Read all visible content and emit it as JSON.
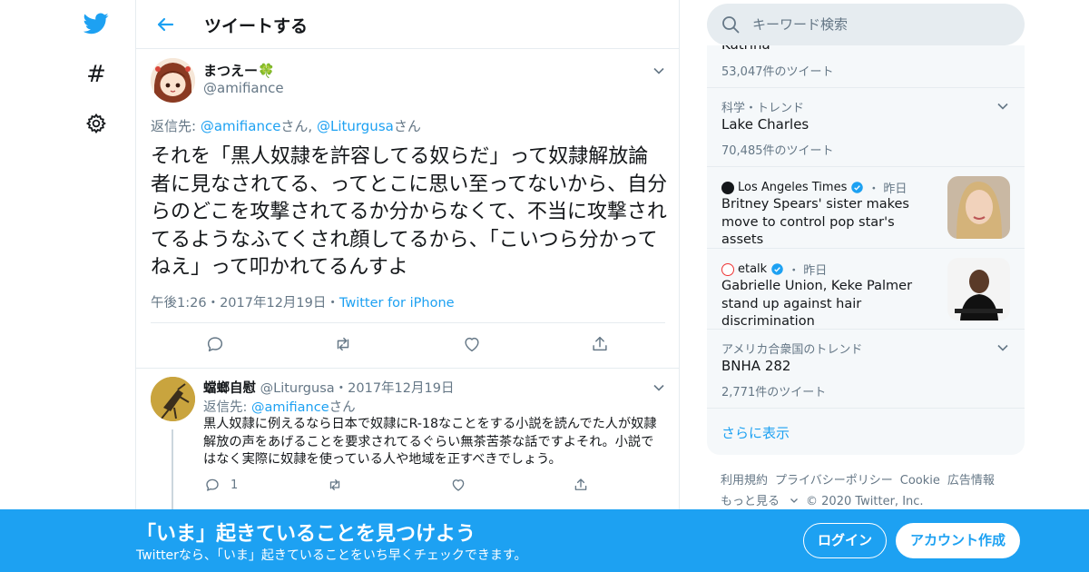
{
  "header": {
    "title": "ツイートする"
  },
  "nav": {
    "hash_symbol": "#"
  },
  "tweet": {
    "user_name": "まつえー🍀",
    "handle": "@amifiance",
    "reply_to_prefix": "返信先: ",
    "reply_to_users": [
      {
        "handle": "@amifiance",
        "suffix": "さん, "
      },
      {
        "handle": "@Liturgusa",
        "suffix": "さん"
      }
    ],
    "text": "それを「黒人奴隷を許容してる奴らだ」って奴隷解放論者に見なされてる、ってとこに思い至ってないから、自分らのどこを攻撃されてるか分からなくて、不当に攻撃されてるようなふてくされ顔してるから、「こいつら分かってねえ」って叩かれてるんすよ",
    "time": "午後1:26",
    "date": "2017年12月19日",
    "source": "Twitter for iPhone"
  },
  "reply": {
    "user_name": "蟷螂自慰",
    "handle": "@Liturgusa",
    "date": "2017年12月19日",
    "reply_to_prefix": "返信先: ",
    "reply_to_handle": "@amifiance",
    "reply_to_suffix": "さん",
    "text": "黒人奴隷に例えるなら日本で奴隷にR-18なことをする小説を読んでた人が奴隷解放の声をあげることを要求されてるぐらい無茶苦茶な話ですよそれ。小説ではなく実際に奴隷を使っている人や地域を正すべきでしょう。",
    "reply_count": "1"
  },
  "search": {
    "placeholder": "キーワード検索"
  },
  "trends": {
    "partial_top": {
      "name": "Katrina",
      "count": "53,047件のツイート"
    },
    "items": [
      {
        "category": "科学・トレンド",
        "name": "Lake Charles",
        "count": "70,485件のツイート"
      },
      {
        "category": "アメリカ合衆国のトレンド",
        "name": "BNHA 282",
        "count": "2,771件のツイート"
      }
    ],
    "news": [
      {
        "source": "Los Angeles Times",
        "time": "昨日",
        "title": "Britney Spears' sister makes move to control pop star's assets"
      },
      {
        "source": "etalk",
        "time": "昨日",
        "title": "Gabrielle Union, Keke Palmer stand up against hair discrimination"
      }
    ],
    "show_more": "さらに表示",
    "time_sep": "・"
  },
  "footer": {
    "links": [
      "利用規約",
      "プライバシーポリシー",
      "Cookie",
      "広告情報"
    ],
    "more": "もっと見る",
    "copyright": "© 2020 Twitter, Inc."
  },
  "banner": {
    "title": "「いま」起きていることを見つけよう",
    "subtitle": "Twitterなら、「いま」起きていることをいち早くチェックできます。",
    "login": "ログイン",
    "signup": "アカウント作成"
  },
  "colors": {
    "accent": "#1da1f2",
    "text": "#14171a",
    "muted": "#657786",
    "border": "#e6ecf0"
  }
}
